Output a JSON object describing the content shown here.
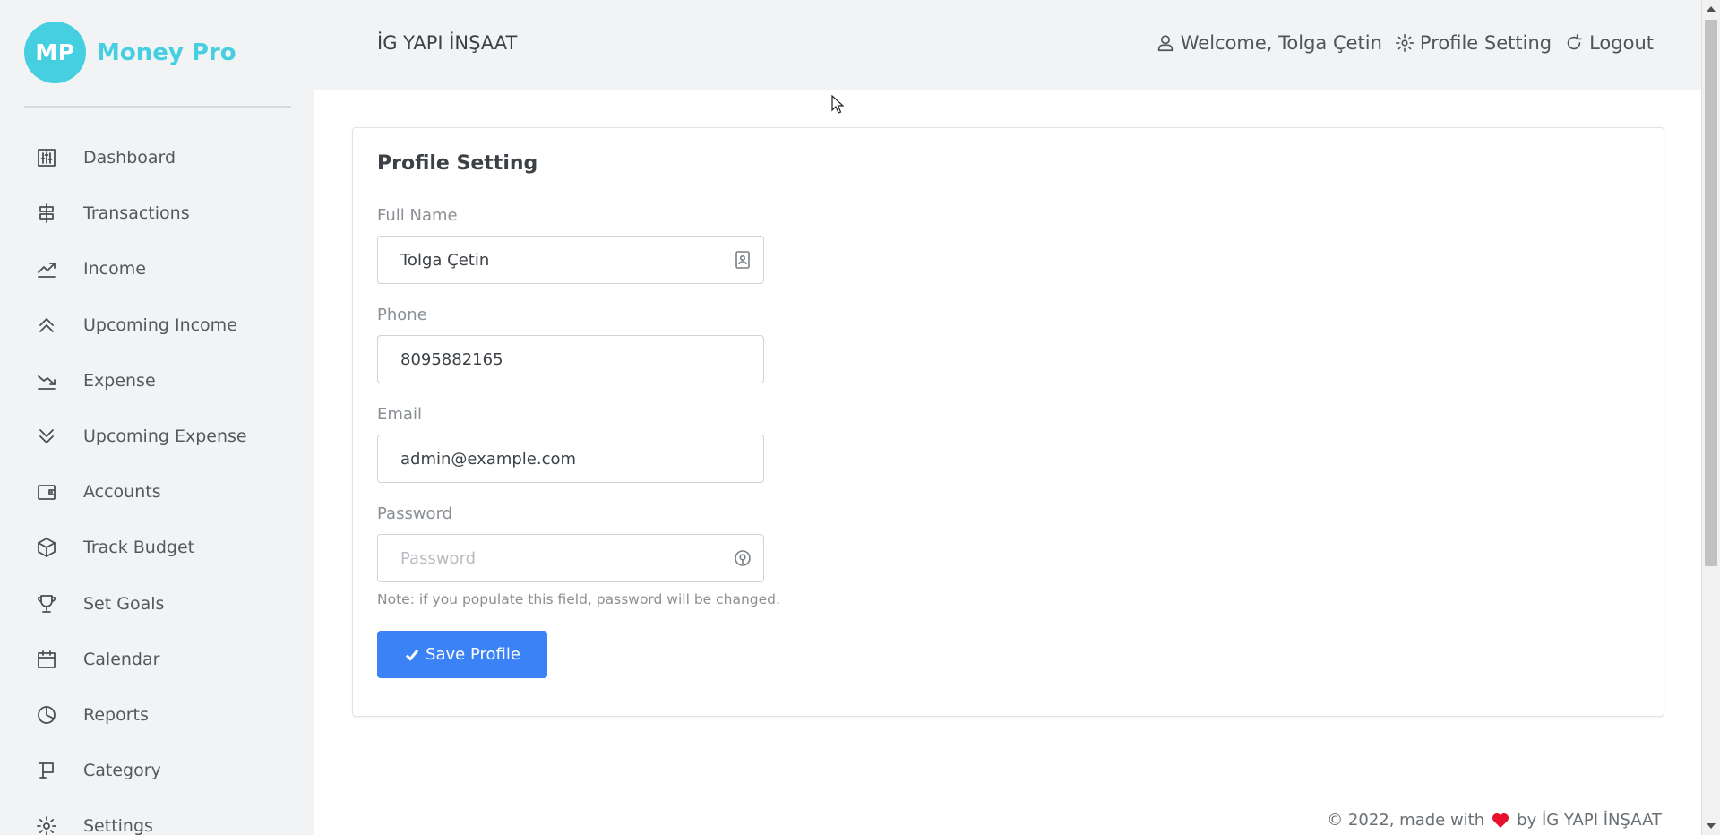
{
  "brand": {
    "logo_text": "MP",
    "name": "Money Pro",
    "color": "#45cfe0"
  },
  "sidebar": {
    "items": [
      {
        "label": "Dashboard",
        "icon": "dashboard-sliders-icon"
      },
      {
        "label": "Transactions",
        "icon": "transactions-icon"
      },
      {
        "label": "Income",
        "icon": "trend-up-icon"
      },
      {
        "label": "Upcoming Income",
        "icon": "double-chevron-up-icon"
      },
      {
        "label": "Expense",
        "icon": "trend-down-icon"
      },
      {
        "label": "Upcoming Expense",
        "icon": "double-chevron-down-icon"
      },
      {
        "label": "Accounts",
        "icon": "wallet-icon"
      },
      {
        "label": "Track Budget",
        "icon": "box-icon"
      },
      {
        "label": "Set Goals",
        "icon": "trophy-icon"
      },
      {
        "label": "Calendar",
        "icon": "calendar-icon"
      },
      {
        "label": "Reports",
        "icon": "pie-chart-icon"
      },
      {
        "label": "Category",
        "icon": "flag-icon"
      },
      {
        "label": "Settings",
        "icon": "gear-icon"
      }
    ]
  },
  "header": {
    "company": "İG YAPI İNŞAAT",
    "welcome": "Welcome, Tolga Çetin",
    "profile_setting": "Profile Setting",
    "logout": "Logout"
  },
  "form": {
    "title": "Profile Setting",
    "full_name": {
      "label": "Full Name",
      "value": "Tolga Çetin",
      "icon": "contact-card-icon"
    },
    "phone": {
      "label": "Phone",
      "value": "8095882165"
    },
    "email": {
      "label": "Email",
      "value": "admin@example.com"
    },
    "password": {
      "label": "Password",
      "placeholder": "Password",
      "value": "",
      "icon": "key-icon"
    },
    "note": "Note: if you populate this field, password will be changed.",
    "save_label": "Save Profile",
    "accent": "#3b82f6"
  },
  "footer": {
    "before": "© 2022, made with",
    "after": "by İG YAPI İNŞAAT",
    "heart_color": "#e8112d"
  }
}
